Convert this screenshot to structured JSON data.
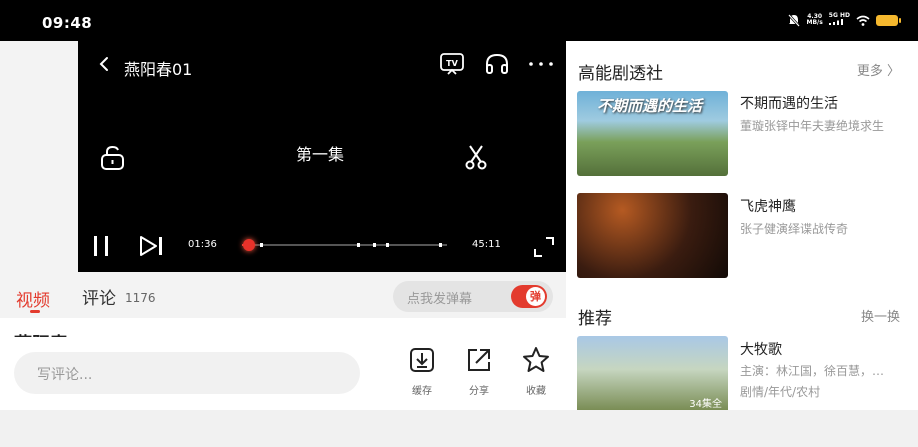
{
  "status_bar": {
    "time": "09:48",
    "net_speed_value": "4.30",
    "net_speed_unit": "MB/s",
    "network_type": "5G HD",
    "icons": [
      "mute-icon",
      "signal-icon",
      "wifi-icon",
      "battery-icon"
    ],
    "battery_color": "#f5b82e"
  },
  "player": {
    "back_icon": "chevron-left-icon",
    "title": "燕阳春01",
    "episode_label": "第一集",
    "current_time": "01:36",
    "total_time": "45:11",
    "progress": 0.035,
    "marker_positions": [
      0.09,
      0.56,
      0.64,
      0.7,
      0.96
    ],
    "accent": "#e9322a"
  },
  "tabs": {
    "video": "视频",
    "comment": "评论",
    "comment_count": "1176",
    "accent": "#e33b2e"
  },
  "danmu": {
    "placeholder": "点我发弹幕",
    "toggle_label": "弹"
  },
  "peek_title": "燕阳春",
  "bottom_bar": {
    "comment_placeholder": "写评论...",
    "actions": [
      {
        "label": "缓存",
        "icon": "download-icon"
      },
      {
        "label": "分享",
        "icon": "share-icon"
      },
      {
        "label": "收藏",
        "icon": "star-icon"
      }
    ]
  },
  "drama_section": {
    "title": "高能剧透社",
    "more": "更多 〉",
    "items": [
      {
        "title": "不期而遇的生活",
        "subtitle": "董璇张铎中年夫妻绝境求生",
        "thumb_caption": "不期而遇的生活"
      },
      {
        "title": "飞虎神鹰",
        "subtitle": "张子健演绎谍战传奇"
      }
    ]
  },
  "recommend_section": {
    "title": "推荐",
    "refresh": "换一换",
    "items": [
      {
        "title": "大牧歌",
        "cast": "主演：林江国，徐百慧，…",
        "tags": "剧情/年代/农村",
        "episodes": "34集全"
      }
    ]
  }
}
